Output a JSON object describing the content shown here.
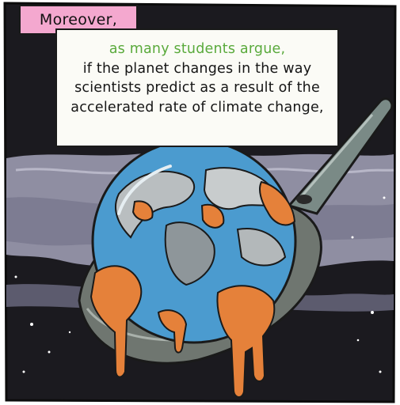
{
  "caption_tag": {
    "text": "Moreover,"
  },
  "caption_box": {
    "lead": "as many students argue,",
    "body": "if the planet changes in the way scientists predict as a result of the accelerated rate of climate change,"
  },
  "colors": {
    "tag_background": "#f4a8cf",
    "lead_text": "#5aaa3c",
    "sky": "#1b1a1f",
    "cloud": "#8f8ea2",
    "pan": "#7a8079",
    "ocean": "#4b9bcf",
    "melt": "#e5813a"
  },
  "icons": {
    "illustration": "melting-earth-in-frying-pan-illustration"
  }
}
